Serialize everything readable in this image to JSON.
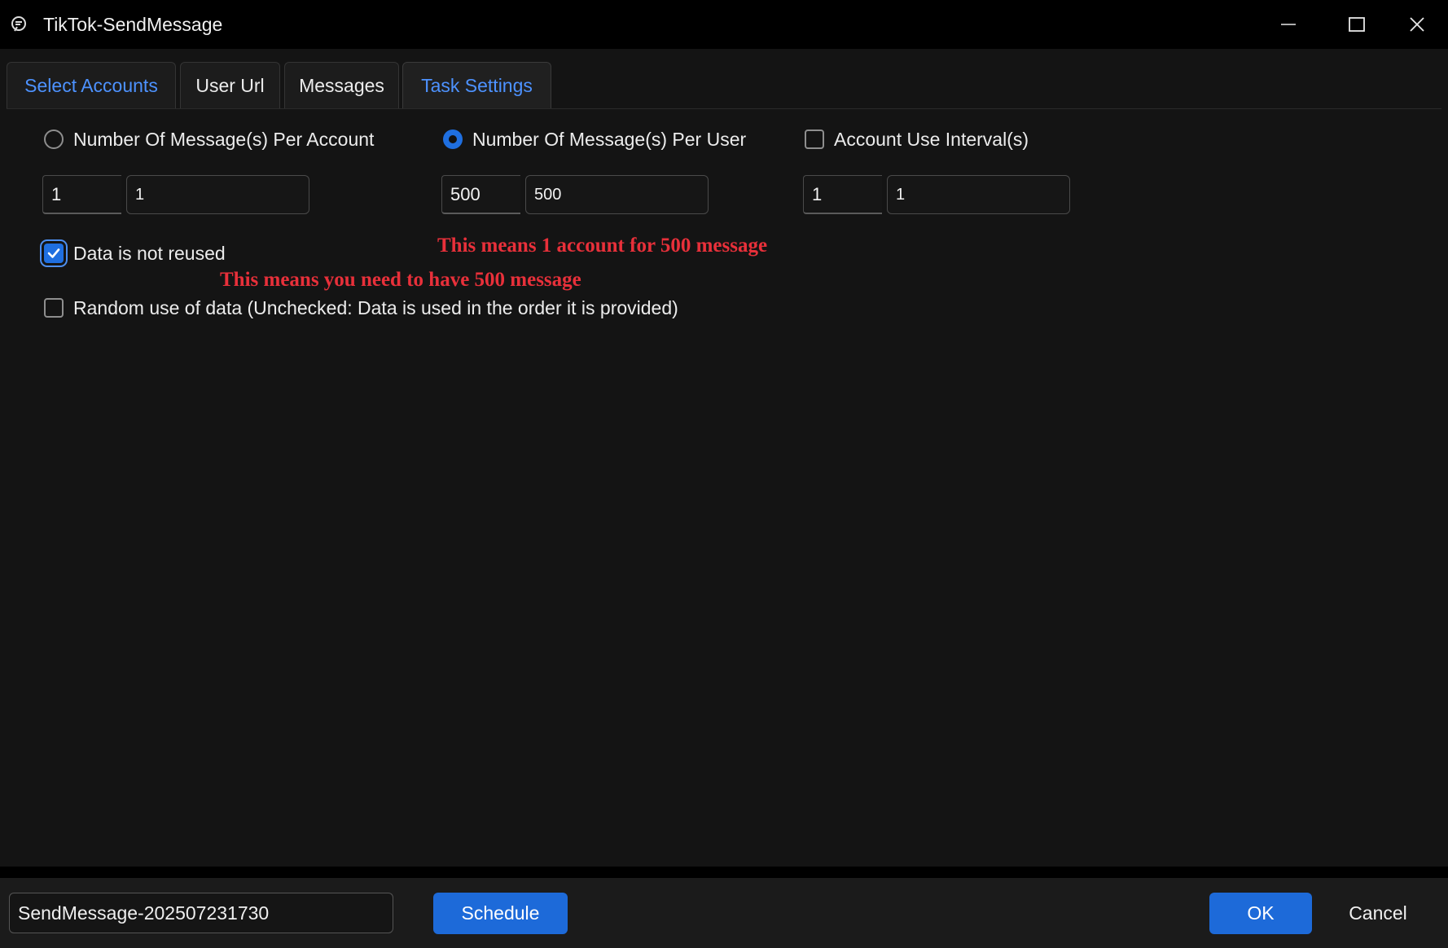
{
  "window": {
    "title": "TikTok-SendMessage",
    "icons": [
      "app-icon",
      "minimize-icon",
      "maximize-icon",
      "close-icon"
    ]
  },
  "tabs": [
    {
      "label": "Select Accounts",
      "active": false
    },
    {
      "label": "User Url",
      "active": false
    },
    {
      "label": "Messages",
      "active": false
    },
    {
      "label": "Task Settings",
      "active": true
    }
  ],
  "settings": {
    "per_account": {
      "label": "Number Of Message(s) Per Account",
      "selected": false,
      "min": "1",
      "max": "1"
    },
    "per_user": {
      "label": "Number Of Message(s) Per User",
      "selected": true,
      "min": "500",
      "max": "500"
    },
    "interval": {
      "label": "Account Use Interval(s)",
      "checked": false,
      "min": "1",
      "max": "1"
    },
    "data_not_reused": {
      "label": "Data is not reused",
      "checked": true
    },
    "random_use": {
      "label": "Random use of data (Unchecked: Data is used in the order it is provided)",
      "checked": false
    }
  },
  "annotations": {
    "note1": "This means 1 account for 500 message",
    "note2": "This means you need to have 500 message",
    "color": "#e8303a"
  },
  "footer": {
    "task_name": "SendMessage-202507231730",
    "schedule_label": "Schedule",
    "ok_label": "OK",
    "cancel_label": "Cancel"
  },
  "colors": {
    "accent": "#1d6ad9",
    "tab_highlight": "#4d92ff",
    "background": "#141414"
  }
}
